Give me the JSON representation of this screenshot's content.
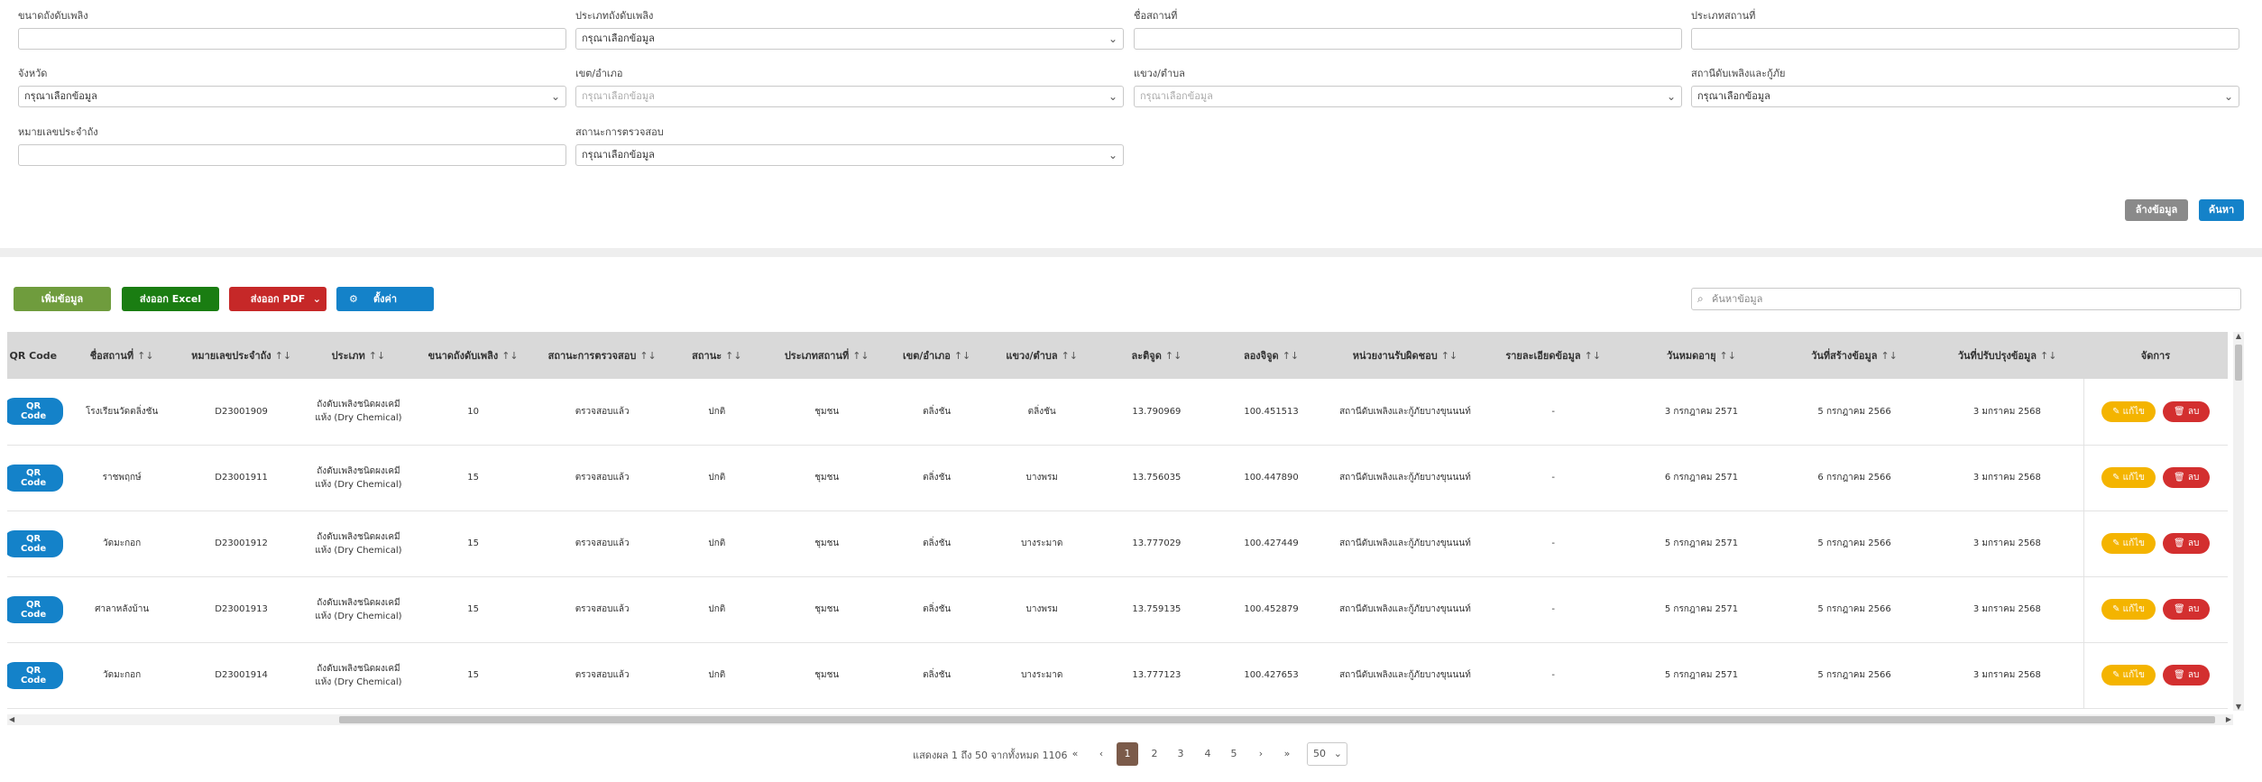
{
  "filters": {
    "tank_size": {
      "label": "ขนาดถังดับเพลิง",
      "value": ""
    },
    "tank_type": {
      "label": "ประเภทถังดับเพลิง",
      "value": "กรุณาเลือกข้อมูล"
    },
    "location_name": {
      "label": "ชื่อสถานที่",
      "value": ""
    },
    "location_type": {
      "label": "ประเภทสถานที่",
      "value": ""
    },
    "province": {
      "label": "จังหวัด",
      "value": "กรุณาเลือกข้อมูล"
    },
    "district": {
      "label": "เขต/อำเภอ",
      "value": "กรุณาเลือกข้อมูล"
    },
    "subdistrict": {
      "label": "แขวง/ตำบล",
      "value": "กรุณาเลือกข้อมูล"
    },
    "station": {
      "label": "สถานีดับเพลิงและกู้ภัย",
      "value": "กรุณาเลือกข้อมูล"
    },
    "tank_number": {
      "label": "หมายเลขประจำถัง",
      "value": ""
    },
    "inspection_status": {
      "label": "สถานะการตรวจสอบ",
      "value": "กรุณาเลือกข้อมูล"
    }
  },
  "buttons": {
    "clear": "ล้างข้อมูล",
    "search": "ค้นหา",
    "add": "เพิ่มข้อมูล",
    "export_excel": "ส่งออก Excel",
    "export_pdf": "ส่งออก PDF",
    "settings": "ตั้งค่า",
    "qr": "QR Code",
    "edit": "แก้ไข",
    "delete": "ลบ"
  },
  "search": {
    "placeholder": "ค้นหาข้อมูล"
  },
  "icons": {
    "chevron": "chevron-down-icon",
    "gear": "gear-icon",
    "magnifier": "search-icon",
    "pencil": "pencil-icon",
    "trash": "trash-icon"
  },
  "colors": {
    "add": "#6f9c3d",
    "excel": "#1a7d12",
    "pdf": "#c62828",
    "settings": "#1482c9",
    "clear": "#8a8a8a",
    "search": "#1482c9"
  },
  "table": {
    "columns": [
      {
        "label": "QR Code",
        "sortable": false
      },
      {
        "label": "ชื่อสถานที่",
        "sortable": true
      },
      {
        "label": "หมายเลขประจำถัง",
        "sortable": true
      },
      {
        "label": "ประเภท",
        "sortable": true
      },
      {
        "label": "ขนาดถังดับเพลิง",
        "sortable": true
      },
      {
        "label": "สถานะการตรวจสอบ",
        "sortable": true
      },
      {
        "label": "สถานะ",
        "sortable": true
      },
      {
        "label": "ประเภทสถานที่",
        "sortable": true
      },
      {
        "label": "เขต/อำเภอ",
        "sortable": true
      },
      {
        "label": "แขวง/ตำบล",
        "sortable": true
      },
      {
        "label": "ละติจูด",
        "sortable": true
      },
      {
        "label": "ลองจิจูด",
        "sortable": true
      },
      {
        "label": "หน่วยงานรับผิดชอบ",
        "sortable": true
      },
      {
        "label": "รายละเอียดข้อมูล",
        "sortable": true
      },
      {
        "label": "วันหมดอายุ",
        "sortable": true
      },
      {
        "label": "วันที่สร้างข้อมูล",
        "sortable": true
      },
      {
        "label": "วันที่ปรับปรุงข้อมูล",
        "sortable": true
      },
      {
        "label": "จัดการ",
        "sortable": false
      }
    ],
    "rows": [
      [
        "โรงเรียนวัดตลิ่งชัน",
        "D23001909",
        "ถังดับเพลิงชนิดผงเคมีแห้ง (Dry Chemical)",
        "10",
        "ตรวจสอบแล้ว",
        "ปกติ",
        "ชุมชน",
        "ตลิ่งชัน",
        "ตลิ่งชัน",
        "13.790969",
        "100.451513",
        "สถานีดับเพลิงและกู้ภัยบางขุนนนท์",
        "-",
        "3 กรกฎาคม 2571",
        "5 กรกฎาคม 2566",
        "3 มกราคม 2568"
      ],
      [
        "ราชพฤกษ์",
        "D23001911",
        "ถังดับเพลิงชนิดผงเคมีแห้ง (Dry Chemical)",
        "15",
        "ตรวจสอบแล้ว",
        "ปกติ",
        "ชุมชน",
        "ตลิ่งชัน",
        "บางพรม",
        "13.756035",
        "100.447890",
        "สถานีดับเพลิงและกู้ภัยบางขุนนนท์",
        "-",
        "6 กรกฎาคม 2571",
        "6 กรกฎาคม 2566",
        "3 มกราคม 2568"
      ],
      [
        "วัดมะกอก",
        "D23001912",
        "ถังดับเพลิงชนิดผงเคมีแห้ง (Dry Chemical)",
        "15",
        "ตรวจสอบแล้ว",
        "ปกติ",
        "ชุมชน",
        "ตลิ่งชัน",
        "บางระมาด",
        "13.777029",
        "100.427449",
        "สถานีดับเพลิงและกู้ภัยบางขุนนนท์",
        "-",
        "5 กรกฎาคม 2571",
        "5 กรกฎาคม 2566",
        "3 มกราคม 2568"
      ],
      [
        "ศาลาหลังบ้าน",
        "D23001913",
        "ถังดับเพลิงชนิดผงเคมีแห้ง (Dry Chemical)",
        "15",
        "ตรวจสอบแล้ว",
        "ปกติ",
        "ชุมชน",
        "ตลิ่งชัน",
        "บางพรม",
        "13.759135",
        "100.452879",
        "สถานีดับเพลิงและกู้ภัยบางขุนนนท์",
        "-",
        "5 กรกฎาคม 2571",
        "5 กรกฎาคม 2566",
        "3 มกราคม 2568"
      ],
      [
        "วัดมะกอก",
        "D23001914",
        "ถังดับเพลิงชนิดผงเคมีแห้ง (Dry Chemical)",
        "15",
        "ตรวจสอบแล้ว",
        "ปกติ",
        "ชุมชน",
        "ตลิ่งชัน",
        "บางระมาด",
        "13.777123",
        "100.427653",
        "สถานีดับเพลิงและกู้ภัยบางขุนนนท์",
        "-",
        "5 กรกฎาคม 2571",
        "5 กรกฎาคม 2566",
        "3 มกราคม 2568"
      ]
    ]
  },
  "pagination": {
    "info": "แสดงผล 1 ถึง 50 จากทั้งหมด 1106",
    "first": "«",
    "prev": "‹",
    "pages": [
      "1",
      "2",
      "3",
      "4",
      "5"
    ],
    "next": "›",
    "last": "»",
    "page_size": "50"
  }
}
